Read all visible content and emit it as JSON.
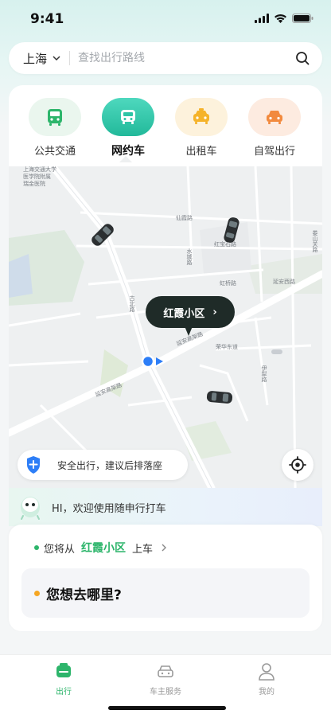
{
  "status_bar": {
    "time": "9:41"
  },
  "search": {
    "city": "上海",
    "placeholder": "查找出行路线"
  },
  "categories": [
    {
      "label": "公共交通",
      "icon": "bus-icon",
      "active": false,
      "color": "#2db56b"
    },
    {
      "label": "网约车",
      "icon": "car-icon",
      "active": true,
      "color": "#2ec4a5"
    },
    {
      "label": "出租车",
      "icon": "taxi-icon",
      "active": false,
      "color": "#f5b32a"
    },
    {
      "label": "自驾出行",
      "icon": "self-drive-icon",
      "active": false,
      "color": "#f28a3e"
    }
  ],
  "map": {
    "labels": {
      "top_left_1": "上海交通大学",
      "top_left_2": "医学院附属",
      "top_left_3": "瑞金医院",
      "road_1": "仙霞路",
      "road_2": "水城路",
      "road_3": "红宝石路",
      "road_4": "虹桥路",
      "road_5": "延安西路",
      "road_6": "古北路",
      "road_7": "延安高架路",
      "road_8": "荣华东道",
      "road_9": "伊犁路",
      "road_10": "延安高架路",
      "road_11": "娄山关路",
      "road_12": "延安西路"
    }
  },
  "location_popup": {
    "name": "红霞小区",
    "chevron": "›"
  },
  "safety_tip": {
    "text": "安全出行，建议后排落座"
  },
  "welcome": {
    "text": "HI，欢迎使用随申行打车"
  },
  "booking": {
    "pickup_prefix": "您将从",
    "pickup_location": "红霞小区",
    "pickup_suffix": "上车",
    "destination_prompt": "您想去哪里?"
  },
  "tabs": [
    {
      "label": "出行",
      "icon": "travel-icon",
      "active": true
    },
    {
      "label": "车主服务",
      "icon": "car-owner-icon",
      "active": false
    },
    {
      "label": "我的",
      "icon": "profile-icon",
      "active": false
    }
  ],
  "colors": {
    "brand_green": "#2db56b",
    "teal": "#2ec4a5",
    "popup_dark": "#1f2b28"
  }
}
